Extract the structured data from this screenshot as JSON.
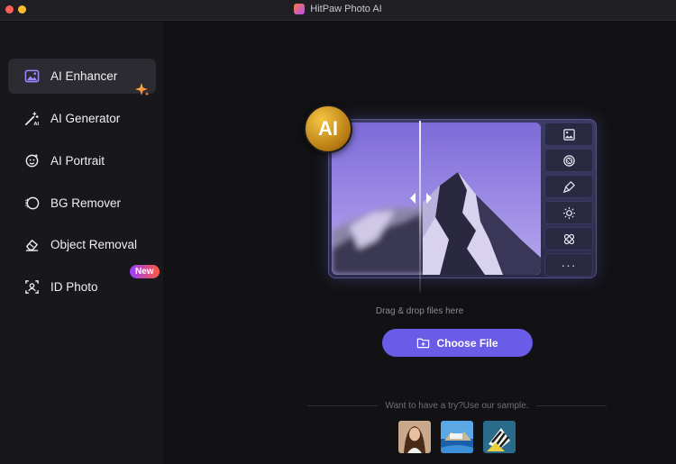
{
  "window": {
    "title": "HitPaw Photo AI"
  },
  "sidebar": {
    "items": [
      {
        "label": "AI Enhancer",
        "icon": "image-enhance-icon",
        "active": true
      },
      {
        "label": "AI Generator",
        "icon": "magic-wand-icon",
        "active": false
      },
      {
        "label": "AI Portrait",
        "icon": "portrait-icon",
        "active": false
      },
      {
        "label": "BG Remover",
        "icon": "bg-remove-icon",
        "active": false
      },
      {
        "label": "Object Removal",
        "icon": "eraser-icon",
        "active": false
      },
      {
        "label": "ID Photo",
        "icon": "id-photo-icon",
        "active": false
      }
    ],
    "new_badge": "New"
  },
  "main": {
    "ai_badge": "AI",
    "tools": [
      "image-icon",
      "filter-icon",
      "brush-icon",
      "brightness-icon",
      "bandage-icon"
    ],
    "tools_more": "···",
    "drag_text": "Drag & drop files here",
    "choose_label": "Choose File",
    "sample_text": "Want to have a try?Use our sample.",
    "samples": [
      "portrait-sample",
      "coast-sample",
      "fish-sample"
    ]
  },
  "colors": {
    "accent": "#6b5ce8",
    "sidebar_bg": "#18181c",
    "main_bg": "#121215"
  }
}
